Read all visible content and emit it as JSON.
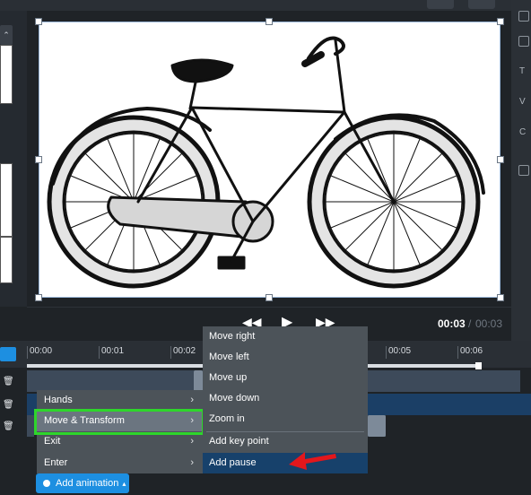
{
  "playback": {
    "rewind_icon": "rewind-icon",
    "play_icon": "play-icon",
    "forward_icon": "fast-forward-icon",
    "current_time": "00:03",
    "separator": "/",
    "total_time": "00:03"
  },
  "timeline": {
    "ticks": [
      "00:00",
      "00:01",
      "00:02",
      "00:05",
      "00:06"
    ]
  },
  "menu_left": {
    "items": [
      {
        "label": "Hands",
        "chevron": "›"
      },
      {
        "label": "Move & Transform",
        "chevron": "›"
      },
      {
        "label": "Exit",
        "chevron": "›"
      },
      {
        "label": "Enter",
        "chevron": "›"
      }
    ]
  },
  "menu_right": {
    "items": [
      {
        "label": "Move right"
      },
      {
        "label": "Move left"
      },
      {
        "label": "Move up"
      },
      {
        "label": "Move down"
      },
      {
        "label": "Zoom in"
      },
      {
        "label": "Add key point"
      },
      {
        "label": "Add pause"
      }
    ]
  },
  "add_animation": {
    "label": "Add animation",
    "caret": "▴"
  },
  "right_panel": {
    "letters": [
      "T",
      "V",
      "C"
    ]
  },
  "colors": {
    "accent": "#1d8fe1",
    "highlight_green": "#2ed62b",
    "arrow_red": "#e3171c",
    "menu_active": "#17416b"
  }
}
